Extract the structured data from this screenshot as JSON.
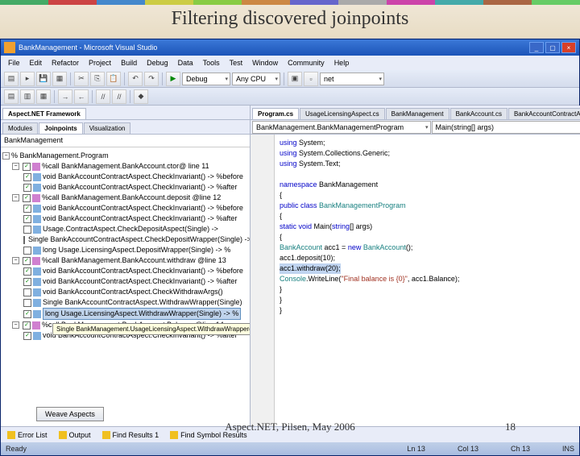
{
  "slide": {
    "title": "Filtering discovered joinpoints",
    "footer": "Aspect.NET, Pilsen, May 2006",
    "page": "18"
  },
  "window": {
    "title": "BankManagement - Microsoft Visual Studio"
  },
  "menu": {
    "items": [
      "File",
      "Edit",
      "Refactor",
      "Project",
      "Build",
      "Debug",
      "Data",
      "Tools",
      "Test",
      "Window",
      "Community",
      "Help"
    ]
  },
  "toolbar2": {
    "config": "Debug",
    "platform": "Any CPU",
    "find_placeholder": "net"
  },
  "left_tabs": {
    "header": "Aspect.NET Framework",
    "t1": "Modules",
    "t2": "Joinpoints",
    "t3": "Visualization"
  },
  "tree": {
    "root": "BankManagement",
    "n1": "% BankManagement.Program",
    "n2": "%call BankManagement.BankAccount.ctor@ line 11",
    "n3": "void BankAccountContractAspect.CheckInvariant() -> %before",
    "n4": "void BankAccountContractAspect.CheckInvariant() -> %after",
    "n5": "%call BankManagement.BankAccount.deposit @line 12",
    "n6": "void BankAccountContractAspect.CheckInvariant() -> %before",
    "n7": "void BankAccountContractAspect.CheckInvariant() -> %after",
    "n8": "Usage.ContractAspect.CheckDepositAspect(Single) ->",
    "n9": "Single BankAccountContractAspect.CheckDepositWrapper(Single) ->",
    "n10": "long Usage.LicensingAspect.DepositWrapper(Single) -> %",
    "n11": "%call BankManagement.BankAccount.withdraw @line 13",
    "n12": "void BankAccountContractAspect.CheckInvariant() -> %before",
    "n13": "void BankAccountContractAspect.CheckInvariant() -> %after",
    "n14": "void BankAccountContractAspect.CheckWithdrawArgs()",
    "n15": "Single BankAccountContractAspect.WithdrawWrapper(Single)",
    "n16": "long Usage.LicensingAspect.WithdrawWrapper(Single) -> %",
    "n17": "%call BankManagement.BankAccount.Balance @line 14",
    "n18": "void BankAccountContractAspect.CheckInvariant() -> %after",
    "tooltip": "Single BankManagement.UsageLicensingAspect.WithdrawWrapper(Single)-> %instead %call *BankAccount.withdraw(float)",
    "weave": "Weave Aspects"
  },
  "right_tabs": {
    "t1": "Program.cs",
    "t2": "UsageLicensingAspect.cs",
    "t3": "BankManagement",
    "t4": "BankAccount.cs",
    "t5": "BankAccountContractAspect.cs"
  },
  "code": {
    "nav1": "BankManagement.BankManagementProgram",
    "nav2": "Main(string[] args)",
    "l1a": "using",
    "l1b": " System;",
    "l2a": "using",
    "l2b": " System.Collections.Generic;",
    "l3a": "using",
    "l3b": " System.Text;",
    "l5a": "namespace",
    "l5b": " BankManagement",
    "l6": "{",
    "l7a": "    public class ",
    "l7b": "BankManagementProgram",
    "l8": "    {",
    "l9a": "        static void ",
    "l9b": "Main(",
    "l9c": "string",
    "l9d": "[] args)",
    "l10": "        {",
    "l11a": "            BankAccount",
    "l11b": " acc1 = ",
    "l11c": "new ",
    "l11d": "BankAccount",
    "l11e": "();",
    "l12": "            acc1.deposit(10);",
    "l13": "            acc1.withdraw(20);",
    "l14a": "            Console",
    "l14b": ".WriteLine(",
    "l14c": "\"Final balance is {0}\"",
    "l14d": ", acc1.Balance);",
    "l15": "        }",
    "l16": "    }",
    "l17": "}"
  },
  "bottom": {
    "t1": "Error List",
    "t2": "Output",
    "t3": "Find Results 1",
    "t4": "Find Symbol Results"
  },
  "status": {
    "ready": "Ready",
    "ln": "Ln 13",
    "col": "Col 13",
    "ch": "Ch 13",
    "ins": "INS"
  }
}
